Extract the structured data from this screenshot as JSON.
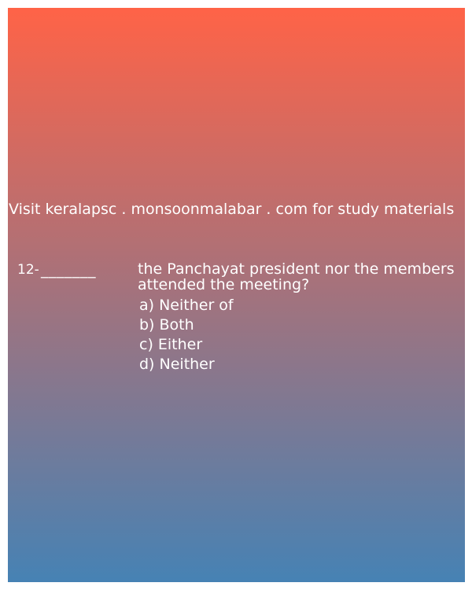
{
  "promo_text": "Visit keralapsc . monsoonmalabar . com for study materials",
  "question": {
    "number": "12-",
    "blank": "_______",
    "text": "the Panchayat president nor the members attended the meeting?",
    "options": [
      "a) Neither of",
      "b) Both",
      "c) Either",
      "d) Neither"
    ]
  },
  "colors": {
    "gradient_top": "#ff6347",
    "gradient_bottom": "#4682b4",
    "text": "#ffffff"
  }
}
